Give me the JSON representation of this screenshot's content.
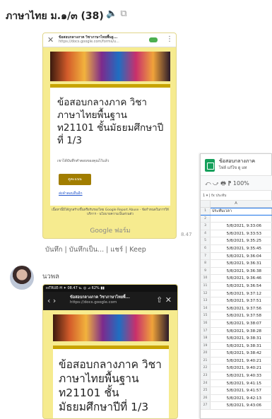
{
  "header": {
    "title": "ภาษาไทย ม.๑/๓ (38)",
    "icons": "🔈 ⧉"
  },
  "message1": {
    "url_title": "ข้อสอบกลางภาค วิชาภาษาไทยพื้นฐ...",
    "url": "https://docs.google.com/forms/u...",
    "form_heading": "ข้อสอบกลางภาค วิชาภาษาไทยพื้นฐาน ท21101 ชั้นมัธยมศึกษาปีที่ 1/3",
    "note": "เขาได้บันทึกคำตอบของคุณไว้แล้ว",
    "button": "ดูคะแนน",
    "link": "ส่งคำตอบอื่นอีก",
    "footer": "เนื้อหานี้มิได้ถูกสร้างขึ้นหรือรับรองโดย Google Report Abuse - ข้อกำหนดในการให้บริการ - นโยบายความเป็นส่วนตัว",
    "brand": "Google ฟอร์ม",
    "time": "8.47",
    "actions": "บันทึก | บันทึกเป็น... | แชร์ | Keep"
  },
  "message2": {
    "sender": "นวพล",
    "status": "ıııTRUE-H ✦     08.47 น.    ◎ ⊿ 62% ▮▮",
    "url_title": "ข้อสอบกลางภาค วิชาภาษาไทยพื้...",
    "url": "https://docs.google.com",
    "form_heading": "ข้อสอบกลางภาค วิชาภาษาไทยพื้นฐาน ท21101 ชั้น มัธยมศึกษาปีที่ 1/3"
  },
  "sheet": {
    "title": "ข้อสอบกลางภาค",
    "menu": "ไฟล์  แก้ไข  ดู  แท",
    "tools": "⤺  ⤻  🖶  ⁋    100%",
    "fx": "1        ▾  |  fx   ประทับ",
    "col_header": "A",
    "rows": [
      {
        "n": "1",
        "v": "ประทับเวลา"
      },
      {
        "n": "2",
        "v": ""
      },
      {
        "n": "3",
        "v": "5/8/2021, 9:33:06"
      },
      {
        "n": "4",
        "v": "5/8/2021, 9:33:53"
      },
      {
        "n": "5",
        "v": "5/8/2021, 9:35:25"
      },
      {
        "n": "6",
        "v": "5/8/2021, 9:35:45"
      },
      {
        "n": "7",
        "v": "5/8/2021, 9:36:04"
      },
      {
        "n": "8",
        "v": "5/8/2021, 9:36:31"
      },
      {
        "n": "9",
        "v": "5/8/2021, 9:36:38"
      },
      {
        "n": "10",
        "v": "5/8/2021, 9:36:46"
      },
      {
        "n": "11",
        "v": "5/8/2021, 9:36:54"
      },
      {
        "n": "12",
        "v": "5/8/2021, 9:37:12"
      },
      {
        "n": "13",
        "v": "5/8/2021, 9:37:51"
      },
      {
        "n": "14",
        "v": "5/8/2021, 9:37:56"
      },
      {
        "n": "15",
        "v": "5/8/2021, 9:37:58"
      },
      {
        "n": "16",
        "v": "5/8/2021, 9:38:07"
      },
      {
        "n": "17",
        "v": "5/8/2021, 9:38:28"
      },
      {
        "n": "18",
        "v": "5/8/2021, 9:38:31"
      },
      {
        "n": "19",
        "v": "5/8/2021, 9:38:31"
      },
      {
        "n": "20",
        "v": "5/8/2021, 9:38:42"
      },
      {
        "n": "21",
        "v": "5/8/2021, 9:40:21"
      },
      {
        "n": "22",
        "v": "5/8/2021, 9:40:21"
      },
      {
        "n": "23",
        "v": "5/8/2021, 9:40:33"
      },
      {
        "n": "24",
        "v": "5/8/2021, 9:41:15"
      },
      {
        "n": "25",
        "v": "5/8/2021, 9:41:57"
      },
      {
        "n": "26",
        "v": "5/8/2021, 9:42:13"
      },
      {
        "n": "27",
        "v": "5/8/2021, 9:43:06"
      }
    ]
  }
}
